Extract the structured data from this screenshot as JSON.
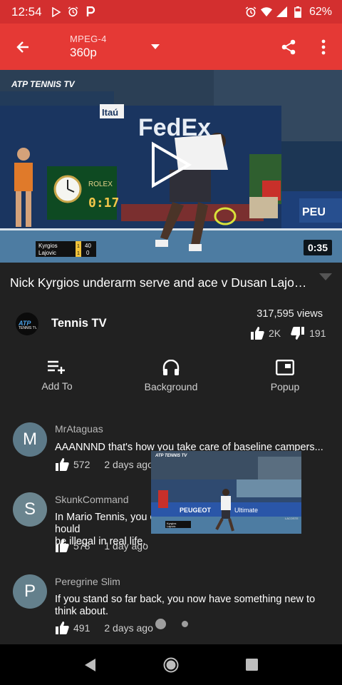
{
  "status_bar": {
    "time": "12:54",
    "battery": "62%",
    "left_icons": [
      "play-store-icon",
      "alarm-icon",
      "p-icon"
    ],
    "right_icons": [
      "alarm-icon",
      "wifi-icon",
      "signal-icon",
      "battery-icon"
    ]
  },
  "toolbar": {
    "format": "MPEG-4",
    "resolution": "360p"
  },
  "video": {
    "duration": "0:35",
    "overlay": {
      "logo": "ATP TENNIS TV",
      "sponsor": "FedEx",
      "bank": "Itaú",
      "clock_brand": "ROLEX",
      "clock_time": "0:17",
      "score_player1": "Kyrgios",
      "score_player2": "Lajovic",
      "score1_set": "1",
      "score1_game": "40",
      "score2_set": "1",
      "score2_game": "0",
      "banner": "PEU"
    }
  },
  "title": "Nick Kyrgios underarm serve and ace v Dusan Lajovi...",
  "channel": {
    "name": "Tennis TV",
    "views": "317,595 views",
    "likes": "2K",
    "dislikes": "191"
  },
  "actions": [
    {
      "label": "Add To",
      "icon": "playlist-add-icon"
    },
    {
      "label": "Background",
      "icon": "headphones-icon"
    },
    {
      "label": "Popup",
      "icon": "popup-icon"
    }
  ],
  "comments": [
    {
      "initial": "M",
      "author": "MrAtaguas",
      "text": "AAANNND that's how you take care of baseline campers...",
      "likes": "572",
      "time": "2 days ago",
      "avatar_color": "#5d7a89"
    },
    {
      "initial": "S",
      "author": "SkunkCommand",
      "text_a": "In Mario Tennis, you c",
      "text_b": "hould",
      "text_c": "be illegal in real life.",
      "likes": "578",
      "time": "1 day ago",
      "avatar_color": "#6b858f"
    },
    {
      "initial": "P",
      "author": "Peregrine Slim",
      "text": "If you stand so far back, you now have something new to think about.",
      "likes": "491",
      "time": "2 days ago",
      "avatar_color": "#64808c"
    }
  ],
  "popup": {
    "logo": "ATP TENNIS TV",
    "banner": "PEUGEOT",
    "banner2": "Ultimate",
    "score": "Kyrgios",
    "score2": "Lajovic",
    "corner": "LACOSTE"
  },
  "colors": {
    "toolbar": "#e53935",
    "status_bar": "#d32f2f",
    "background": "#212121"
  }
}
